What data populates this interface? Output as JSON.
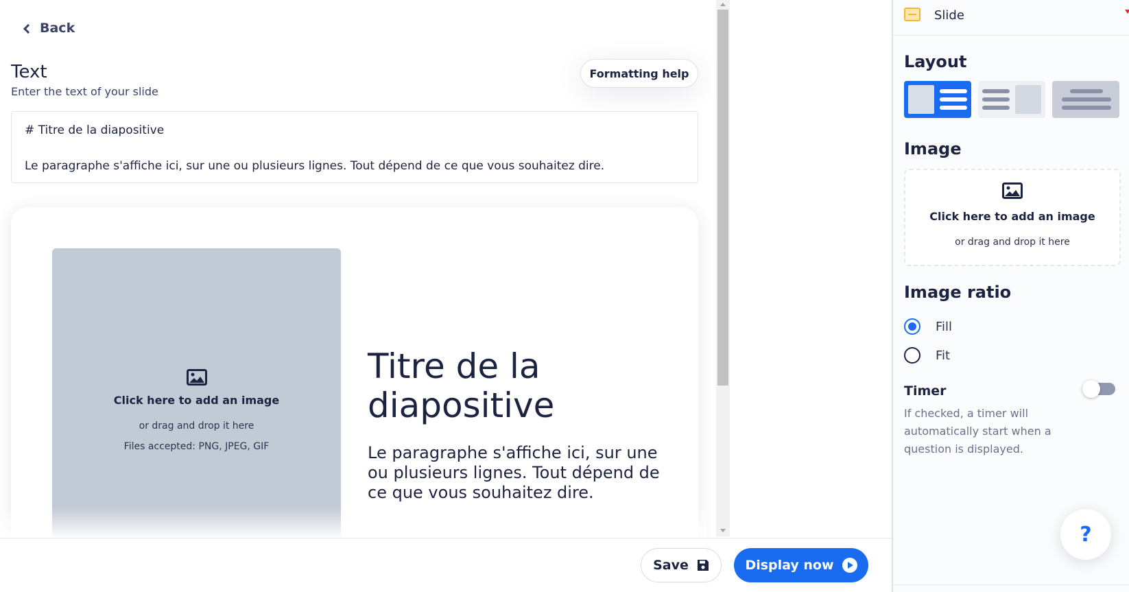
{
  "nav": {
    "back_label": "Back"
  },
  "text_section": {
    "title": "Text",
    "subtitle": "Enter the text of your slide",
    "formatting_help_label": "Formatting help",
    "editor_line1": "# Titre de la diapositive",
    "editor_line2": "Le paragraphe s'affiche ici, sur une ou plusieurs lignes. Tout dépend de ce que vous souhaitez dire."
  },
  "preview": {
    "image_label": "Click here to add an image",
    "image_sub": "or drag and drop it here",
    "image_files": "Files accepted: PNG, JPEG, GIF",
    "title": "Titre de la diapositive",
    "paragraph": "Le paragraphe s'affiche ici, sur une ou plusieurs lignes. Tout dépend de ce que vous souhaitez dire."
  },
  "footer": {
    "save_label": "Save",
    "display_label": "Display now"
  },
  "sidebar": {
    "slide_label": "Slide",
    "layout_heading": "Layout",
    "image_heading": "Image",
    "image_label": "Click here to add an image",
    "image_sub": "or drag and drop it here",
    "ratio_heading": "Image ratio",
    "ratio_options": [
      {
        "label": "Fill",
        "selected": true
      },
      {
        "label": "Fit",
        "selected": false
      }
    ],
    "timer_heading": "Timer",
    "timer_desc": "If checked, a timer will automatically start when a question is displayed.",
    "timer_on": false,
    "help_label": "?"
  },
  "colors": {
    "accent": "#196cf0",
    "text": "#1c2340",
    "placeholder_bg": "#c2cad6"
  }
}
